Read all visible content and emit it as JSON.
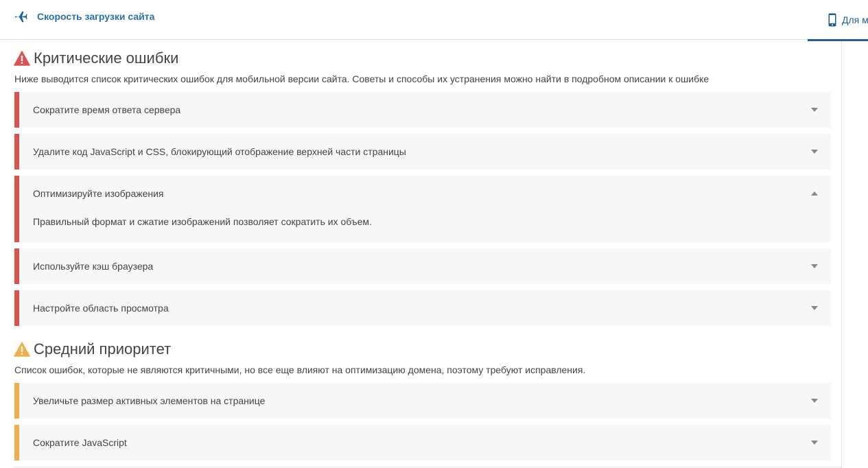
{
  "header": {
    "brand_icon": "plane-icon",
    "title": "Скорость загрузки сайта",
    "tab_mobile": {
      "icon": "phone-icon",
      "label": "Для мобильных"
    }
  },
  "colors": {
    "accent": "#1f5f99",
    "critical": "#d9534f",
    "medium": "#f0ad4e",
    "panel_bg": "#f7f7f7"
  },
  "critical": {
    "icon": "warning-triangle-icon",
    "title": "Критические ошибки",
    "description": "Ниже выводится список критических ошибок для мобильной версии сайта. Советы и способы их устранения можно найти в подробном описании к ошибке",
    "items": [
      {
        "label": "Сократите время ответа сервера",
        "expanded": false
      },
      {
        "label": "Удалите код JavaScript и CSS, блокирующий отображение верхней части страницы",
        "expanded": false
      },
      {
        "label": "Оптимизируйте изображения",
        "expanded": true,
        "detail": "Правильный формат и сжатие изображений позволяет сократить их объем."
      },
      {
        "label": "Используйте кэш браузера",
        "expanded": false
      },
      {
        "label": "Настройте область просмотра",
        "expanded": false
      }
    ]
  },
  "medium": {
    "icon": "warning-triangle-icon",
    "title": "Средний приоритет",
    "description": "Список ошибок, которые не являются критичными, но все еще влияют на оптимизацию домена, поэтому требуют исправления.",
    "items": [
      {
        "label": "Увеличьте размер активных элементов на странице",
        "expanded": false
      },
      {
        "label": "Сократите JavaScript",
        "expanded": false
      }
    ]
  }
}
